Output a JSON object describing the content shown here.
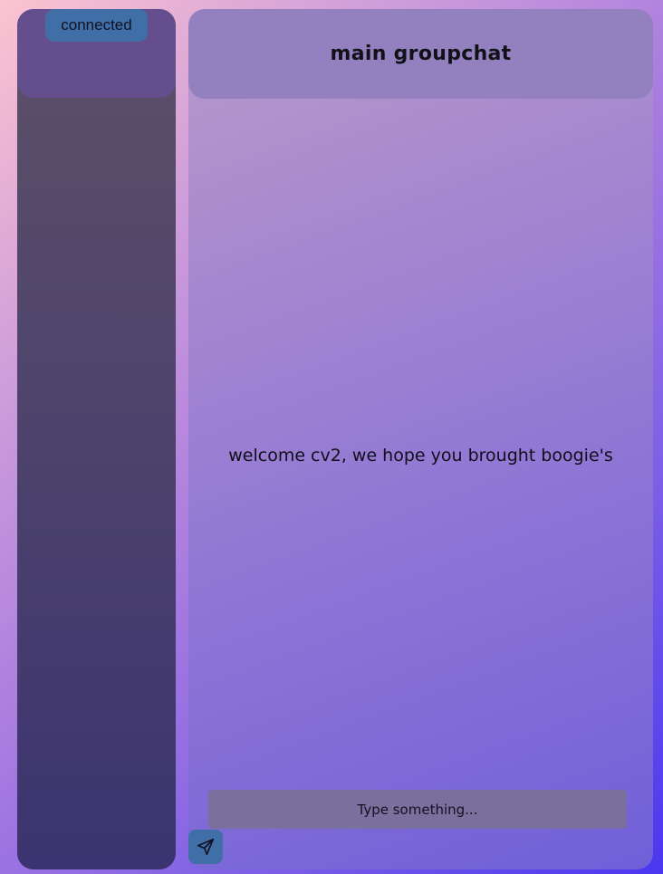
{
  "sidebar": {
    "status": "connected"
  },
  "chat": {
    "title": "main groupchat",
    "welcome": "welcome cv2, we hope you brought boogie's",
    "input": {
      "placeholder": "Type something...",
      "value": ""
    },
    "send_icon": "send-paper-plane-icon"
  },
  "colors": {
    "badge": "#3f6fa6",
    "sidebar_header": "#654e8e",
    "chat_header": "#9380bf",
    "input_bg": "#7a6f9d"
  }
}
